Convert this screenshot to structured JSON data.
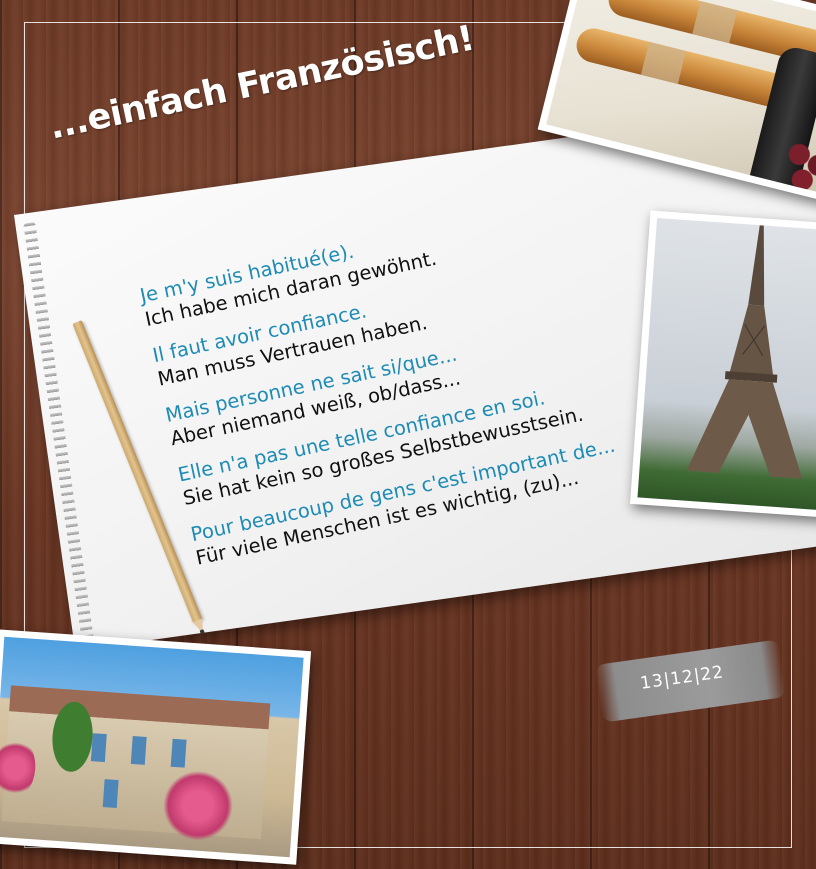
{
  "title": "...einfach Französisch!",
  "phrases": [
    {
      "fr": "Je m'y suis habitué(e).",
      "de": "Ich habe mich daran gewöhnt."
    },
    {
      "fr": "Il faut avoir confiance.",
      "de": "Man muss Vertrauen haben."
    },
    {
      "fr": "Mais personne ne sait si/que...",
      "de": "Aber niemand weiß, ob/dass..."
    },
    {
      "fr": "Elle n'a pas une telle confiance en soi.",
      "de": "Sie hat kein so großes Selbstbewusstsein."
    },
    {
      "fr": "Pour beaucoup de gens c'est important de...",
      "de": "Für viele Menschen ist es wichtig, (zu)..."
    }
  ],
  "date": "13|12|22",
  "colors": {
    "french_text": "#1d8bb5",
    "german_text": "#111111",
    "wood": "#6e3a26"
  },
  "images": [
    "baguette-wine-photo",
    "eiffel-tower-photo",
    "provence-house-photo",
    "pencil",
    "spiral-notebook"
  ]
}
